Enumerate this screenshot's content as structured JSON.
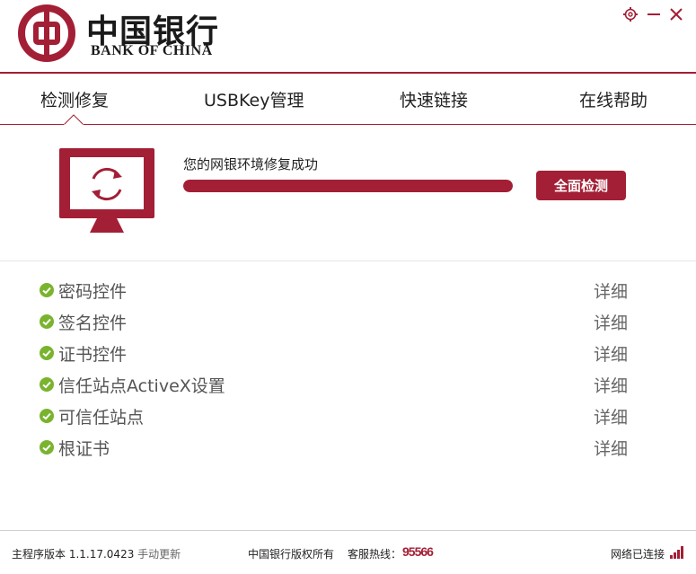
{
  "brand": {
    "name_cn": "中国银行",
    "name_en": "BANK OF CHINA"
  },
  "window_controls": [
    "settings-icon",
    "minimize-icon",
    "close-icon"
  ],
  "tabs": [
    {
      "label": "检测修复",
      "active": true
    },
    {
      "label": "USBKey管理",
      "active": false
    },
    {
      "label": "快速链接",
      "active": false
    },
    {
      "label": "在线帮助",
      "active": false
    }
  ],
  "status": {
    "message": "您的网银环境修复成功",
    "progress": 1.0,
    "scan_button": "全面检测"
  },
  "checks": [
    {
      "label": "密码控件",
      "detail": "详细",
      "ok": true
    },
    {
      "label": "签名控件",
      "detail": "详细",
      "ok": true
    },
    {
      "label": "证书控件",
      "detail": "详细",
      "ok": true
    },
    {
      "label": "信任站点ActiveX设置",
      "detail": "详细",
      "ok": true
    },
    {
      "label": "可信任站点",
      "detail": "详细",
      "ok": true
    },
    {
      "label": "根证书",
      "detail": "详细",
      "ok": true
    }
  ],
  "footer": {
    "version_label": "主程序版本 1.1.17.0423",
    "update_link": "手动更新",
    "copyright": "中国银行版权所有",
    "hotline_label": "客服热线：",
    "hotline_number": "95566",
    "network_status": "网络已连接"
  },
  "colors": {
    "brand_red": "#a31f35",
    "check_green": "#7ab32e"
  }
}
